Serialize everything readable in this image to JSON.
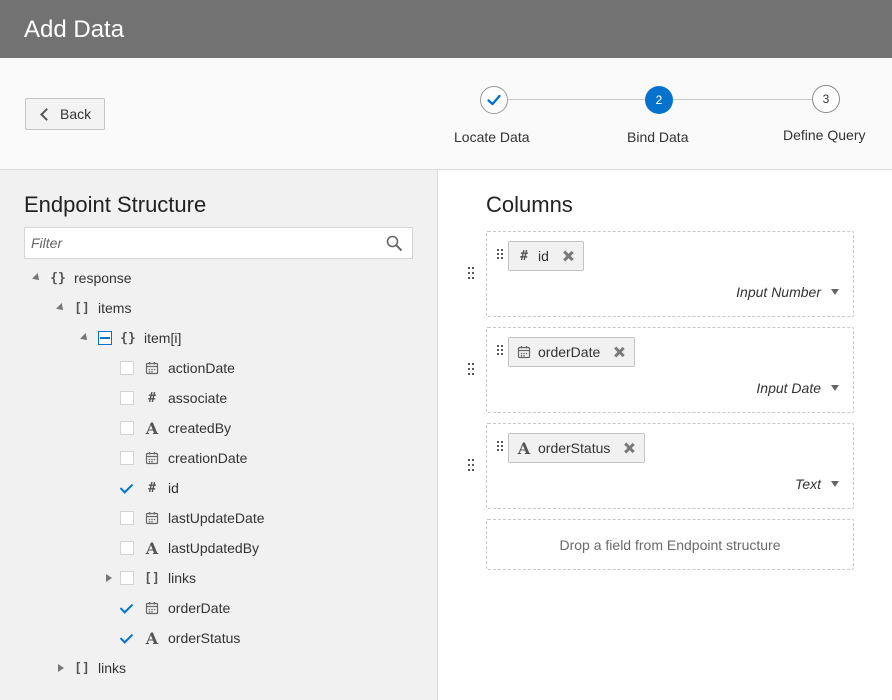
{
  "header": {
    "title": "Add Data"
  },
  "toolbar": {
    "back_label": "Back"
  },
  "train": {
    "steps": [
      {
        "label": "Locate Data",
        "state": "done",
        "number": "1"
      },
      {
        "label": "Bind Data",
        "state": "current",
        "number": "2"
      },
      {
        "label": "Define Query",
        "state": "future",
        "number": "3"
      }
    ]
  },
  "endpoint": {
    "title": "Endpoint Structure",
    "filter_placeholder": "Filter",
    "tree": {
      "response": "response",
      "items": "items",
      "item": "item[i]",
      "fields": [
        {
          "label": "actionDate",
          "type": "date",
          "checked": false
        },
        {
          "label": "associate",
          "type": "number",
          "checked": false
        },
        {
          "label": "createdBy",
          "type": "text",
          "checked": false
        },
        {
          "label": "creationDate",
          "type": "date",
          "checked": false
        },
        {
          "label": "id",
          "type": "number",
          "checked": true
        },
        {
          "label": "lastUpdateDate",
          "type": "date",
          "checked": false
        },
        {
          "label": "lastUpdatedBy",
          "type": "text",
          "checked": false
        },
        {
          "label": "links",
          "type": "array",
          "checked": false
        },
        {
          "label": "orderDate",
          "type": "date",
          "checked": true
        },
        {
          "label": "orderStatus",
          "type": "text",
          "checked": true
        }
      ],
      "links_root": "links"
    }
  },
  "columns": {
    "title": "Columns",
    "items": [
      {
        "field": "id",
        "field_type": "number",
        "component": "Input Number"
      },
      {
        "field": "orderDate",
        "field_type": "date",
        "component": "Input Date"
      },
      {
        "field": "orderStatus",
        "field_type": "text",
        "component": "Text"
      }
    ],
    "drop_hint": "Drop a field from Endpoint structure"
  },
  "colors": {
    "accent": "#0572ce",
    "titlebar": "#727272",
    "left_panel_bg": "#f1f1f1"
  }
}
